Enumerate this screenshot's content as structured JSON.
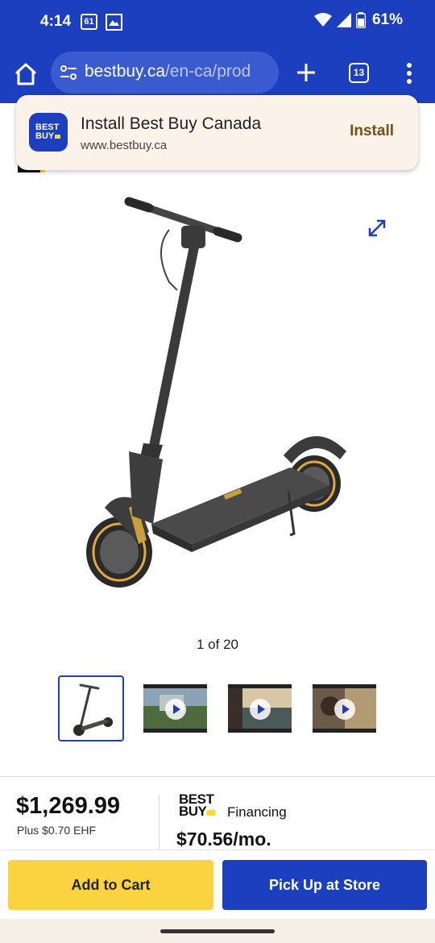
{
  "status_bar": {
    "time": "4:14",
    "notification_badge": "61",
    "battery": "61%"
  },
  "browser": {
    "url_domain": "bestbuy.ca",
    "url_path": "/en-ca/prod",
    "tab_count": "13"
  },
  "install_banner": {
    "logo_line1": "BEST",
    "logo_line2": "BUY",
    "title": "Install Best Buy Canada",
    "domain": "www.bestbuy.ca",
    "install_label": "Install"
  },
  "gallery": {
    "counter": "1 of 20"
  },
  "pricing": {
    "price": "$1,269.99",
    "ehf": "Plus $0.70 EHF",
    "financing_logo_line1": "BEST",
    "financing_logo_line2": "BUY",
    "financing_label": "Financing",
    "monthly": "$70.56/mo."
  },
  "actions": {
    "add_to_cart": "Add to Cart",
    "pick_up": "Pick Up at Store"
  },
  "colors": {
    "brand_blue": "#1c3fbf",
    "cart_yellow": "#fbd240",
    "tag_yellow": "#ffe000"
  }
}
